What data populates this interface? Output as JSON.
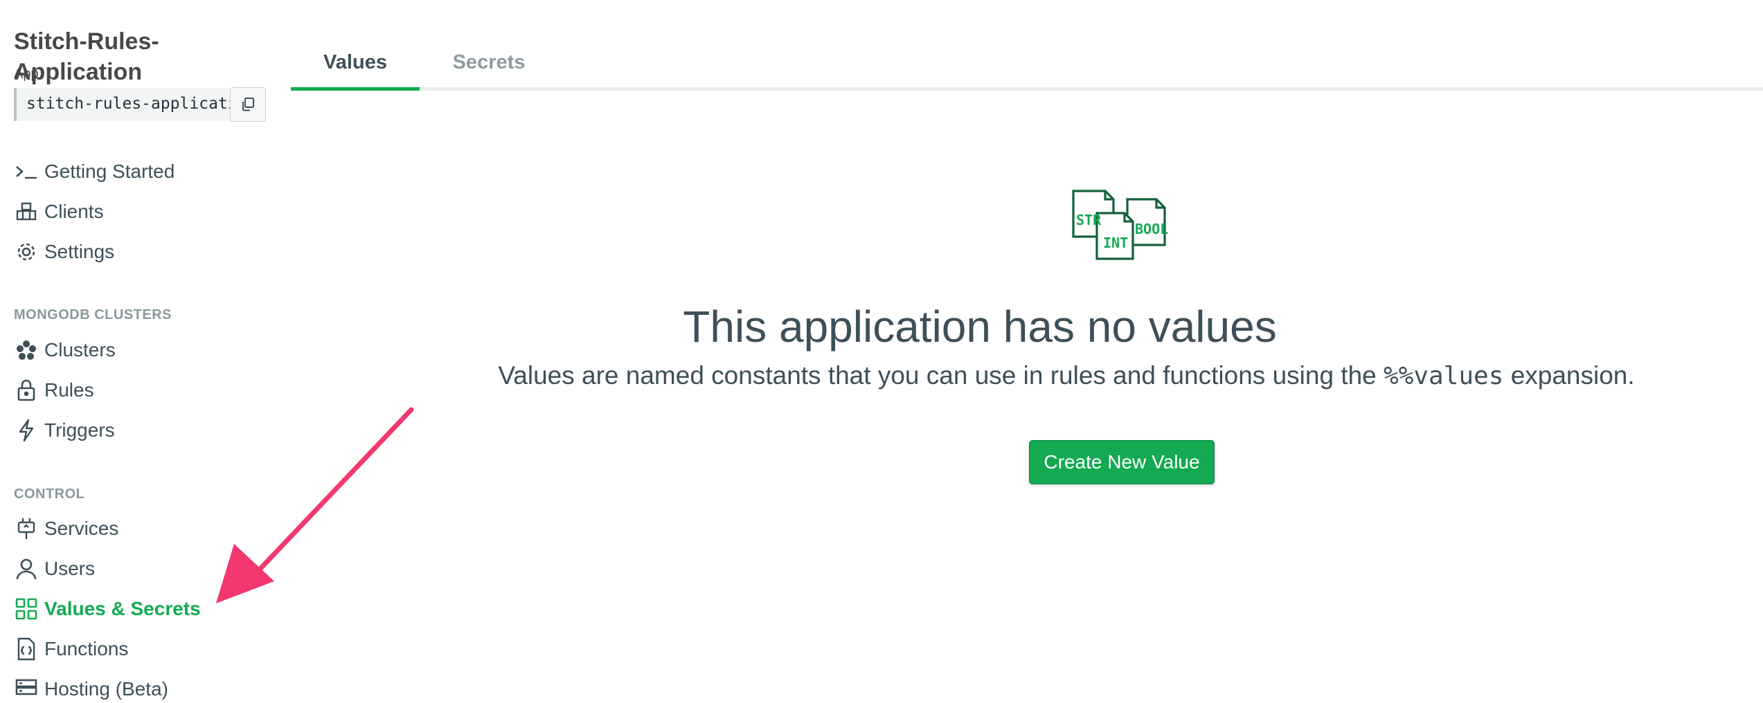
{
  "sidebar": {
    "app_title": "Stitch-Rules-Application",
    "app_id_label": "App",
    "app_id_value": "stitch-rules-application-xyzab",
    "nav_top": [
      {
        "label": "Getting Started",
        "icon": "terminal-icon"
      },
      {
        "label": "Clients",
        "icon": "clients-icon"
      },
      {
        "label": "Settings",
        "icon": "gear-icon"
      }
    ],
    "section_clusters": "MONGODB CLUSTERS",
    "nav_clusters": [
      {
        "label": "Clusters",
        "icon": "clusters-icon"
      },
      {
        "label": "Rules",
        "icon": "lock-icon"
      },
      {
        "label": "Triggers",
        "icon": "bolt-icon"
      }
    ],
    "section_control": "CONTROL",
    "nav_control": [
      {
        "label": "Services",
        "icon": "plug-icon"
      },
      {
        "label": "Users",
        "icon": "user-icon"
      },
      {
        "label": "Values & Secrets",
        "icon": "grid-icon",
        "active": true
      },
      {
        "label": "Functions",
        "icon": "function-file-icon"
      },
      {
        "label": "Hosting (Beta)",
        "icon": "hosting-icon"
      }
    ]
  },
  "tabs": [
    {
      "label": "Values",
      "active": true
    },
    {
      "label": "Secrets",
      "active": false
    }
  ],
  "empty_state": {
    "icon_labels": [
      "STR",
      "INT",
      "BOOL"
    ],
    "title": "This application has no values",
    "description_before": "Values are named constants that you can use in rules and functions using the",
    "description_code": "%%values",
    "description_after": "expansion.",
    "button_label": "Create New Value"
  },
  "colors": {
    "accent": "#13aa52",
    "text": "#3d4f58",
    "muted": "#89989b",
    "annotation_arrow": "#f2386f"
  }
}
